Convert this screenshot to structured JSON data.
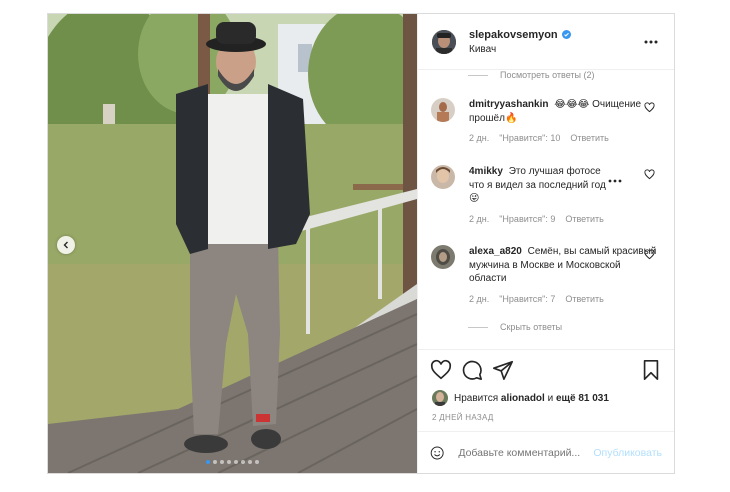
{
  "post": {
    "author": "slepakovsemyon",
    "verified": true,
    "location": "Кивач",
    "carousel": {
      "dot_count": 8,
      "active_index": 0
    }
  },
  "comments_panel": {
    "show_replies": "Посмотреть ответы (2)",
    "hide_replies": "Скрыть ответы",
    "comments": [
      {
        "user": "dmitryyashankin",
        "text": "😂😂😂 Очищение прошёл🔥",
        "age": "2 дн.",
        "likes": "\"Нравится\": 10",
        "reply": "Ответить"
      },
      {
        "user": "4mikky",
        "text": "Это лучшая фотосе... что я видел за последний год 😜",
        "text_line1": "Это лучшая фотосе",
        "text_line2": "что я видел за последний год",
        "age": "2 дн.",
        "likes": "\"Нравится\": 9",
        "reply": "Ответить"
      },
      {
        "user": "alexa_a820",
        "text": "Семён, вы самый красивый мужчина в Москве и Московской области",
        "age": "2 дн.",
        "likes": "\"Нравится\": 7",
        "reply": "Ответить"
      }
    ]
  },
  "likes": {
    "prefix": "Нравится",
    "user": "alionadol",
    "connector": "и",
    "others": "ещё 81 031"
  },
  "timestamp": "2 ДНЕЙ НАЗАД",
  "add_comment": {
    "placeholder": "Добавьте комментарий...",
    "post_label": "Опубликовать"
  },
  "colors": {
    "verified": "#3897f0",
    "link_disabled": "#b2dffc",
    "muted": "#8e8e8e",
    "text": "#262626"
  }
}
